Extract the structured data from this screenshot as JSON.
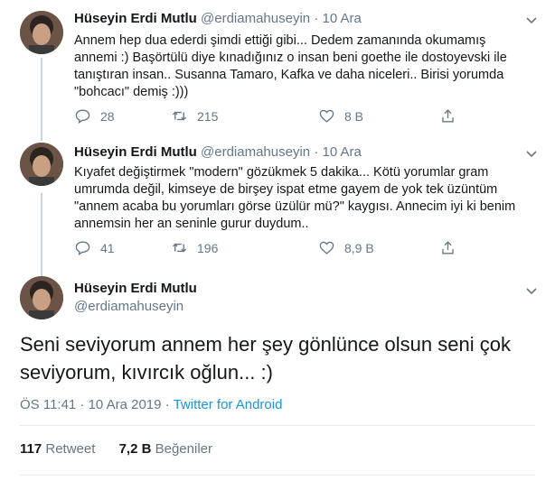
{
  "tweets": [
    {
      "name": "Hüseyin Erdi Mutlu",
      "handle": "@erdiamahuseyin",
      "dot": "·",
      "date": "10 Ara",
      "text": "Annem hep dua ederdi şimdi ettiği gibi... Dedem zamanında okumamış annemi :) Başörtülü diye kınadığınız o insan beni goethe ile dostoyevski ile tanıştıran insan.. Susanna Tamaro, Kafka ve daha niceleri.. Birisi yorumda \"bohcacı\" demiş :)))",
      "replies": "28",
      "retweets": "215",
      "likes": "8 B"
    },
    {
      "name": "Hüseyin Erdi Mutlu",
      "handle": "@erdiamahuseyin",
      "dot": "·",
      "date": "10 Ara",
      "text": "Kıyafet değiştirmek \"modern\" gözükmek 5 dakika... Kötü yorumlar gram umrumda değil, kimseye de birşey ispat etme gayem de yok tek üzüntüm \"annem acaba bu yorumları görse üzülür mü?\" kaygısı. Annecim iyi ki benim annemsin her an seninle gurur duydum..",
      "replies": "41",
      "retweets": "196",
      "likes": "8,9 B"
    }
  ],
  "main_tweet": {
    "name": "Hüseyin Erdi Mutlu",
    "handle": "@erdiamahuseyin",
    "text": "Seni seviyorum annem her şey gönlünce olsun seni çok seviyorum, kıvırcık oğlun... :)",
    "time": "ÖS 11:41 · 10 Ara 2019 · ",
    "source": "Twitter for Android",
    "retweet_count": "117",
    "retweet_label": "Retweet",
    "like_count": "7,2 B",
    "like_label": "Beğeniler"
  },
  "icons": [
    "chevron-down-icon",
    "reply-icon",
    "retweet-icon",
    "like-icon",
    "share-icon"
  ],
  "colors": {
    "text": "#14171a",
    "secondary": "#657786",
    "link": "#1b95e0",
    "divider": "#e6ecf0",
    "thread_line": "#ccd6dd"
  }
}
